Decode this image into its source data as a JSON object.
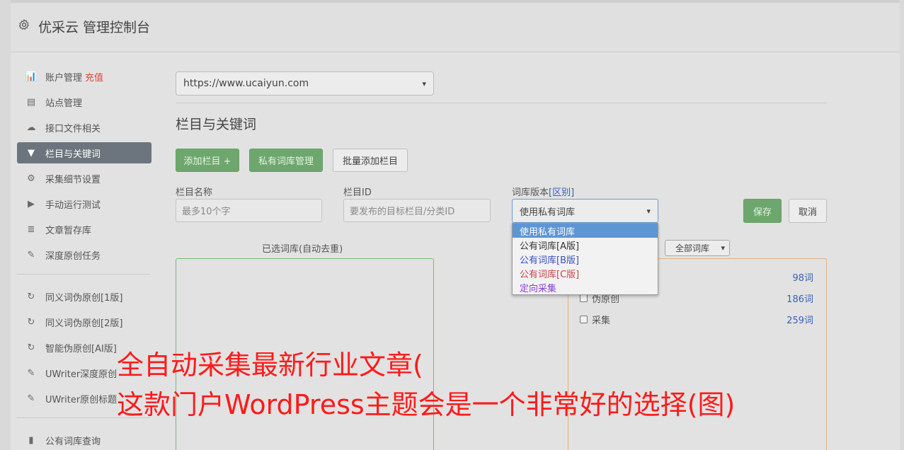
{
  "header": {
    "title": "优采云 管理控制台",
    "icon": "gear-icon"
  },
  "sidebar": {
    "group1": [
      {
        "label": "账户管理",
        "badge": "充值",
        "icon": "chart-icon",
        "glyph": "📊"
      },
      {
        "label": "站点管理",
        "icon": "server-icon",
        "glyph": "▤"
      },
      {
        "label": "接口文件相关",
        "icon": "cloud-upload-icon",
        "glyph": "☁"
      },
      {
        "label": "栏目与关键词",
        "icon": "filter-icon",
        "glyph": "▼",
        "active": true
      },
      {
        "label": "采集细节设置",
        "icon": "cogs-icon",
        "glyph": "⚙"
      },
      {
        "label": "手动运行测试",
        "icon": "play-icon",
        "glyph": "▶"
      },
      {
        "label": "文章暂存库",
        "icon": "database-icon",
        "glyph": "≣"
      },
      {
        "label": "深度原创任务",
        "icon": "edit-icon",
        "glyph": "✎"
      }
    ],
    "group2": [
      {
        "label": "同义词伪原创[1版]",
        "icon": "refresh-icon",
        "glyph": "↻"
      },
      {
        "label": "同义词伪原创[2版]",
        "icon": "refresh-icon",
        "glyph": "↻"
      },
      {
        "label": "智能伪原创[AI版]",
        "icon": "refresh-icon",
        "glyph": "↻"
      },
      {
        "label": "UWriter深度原创",
        "icon": "edit-icon",
        "glyph": "✎"
      },
      {
        "label": "UWriter原创标题",
        "icon": "edit-icon",
        "glyph": "✎"
      }
    ],
    "group3": [
      {
        "label": "公有词库查询",
        "icon": "book-icon",
        "glyph": "▮"
      }
    ]
  },
  "main": {
    "site_select": "https://www.ucaiyun.com",
    "section_title": "栏目与关键词",
    "buttons": {
      "add_column": "添加栏目 +",
      "private_lib": "私有词库管理",
      "batch_add": "批量添加栏目"
    },
    "labels": {
      "column_name": "栏目名称",
      "column_id": "栏目ID",
      "lib_version": "词库版本",
      "lib_version_link": "[区别]"
    },
    "placeholders": {
      "column_name": "最多10个字",
      "column_id": "要发布的目标栏目/分类ID"
    },
    "version_select": "使用私有词库",
    "dropdown": [
      {
        "label": "使用私有词库",
        "color": "#ffffff",
        "selected": true
      },
      {
        "label": "公有词库[A版]",
        "color": "#333333"
      },
      {
        "label": "公有词库[B版]",
        "color": "#3a4fc0"
      },
      {
        "label": "公有词库[C版]",
        "color": "#c8444c"
      },
      {
        "label": "定向采集",
        "color": "#8a3fd1"
      }
    ],
    "save": "保存",
    "cancel": "取消",
    "selected_title": "已选词库(自动去重)",
    "lib_filter": "全部词库",
    "libs": [
      {
        "label": "",
        "count": "98词"
      },
      {
        "label": "伪原创",
        "count": "186词"
      },
      {
        "label": "采集",
        "count": "259词"
      }
    ]
  },
  "overlay": {
    "line1": "全自动采集最新行业文章(",
    "line2": "这款门户WordPress主题会是一个非常好的选择(图)"
  },
  "colors": {
    "accent_green": "#6ea76e",
    "active_nav": "#6c757d",
    "overlay_text": "#ff1a1a",
    "dropdown_highlight": "#5e95d3"
  }
}
